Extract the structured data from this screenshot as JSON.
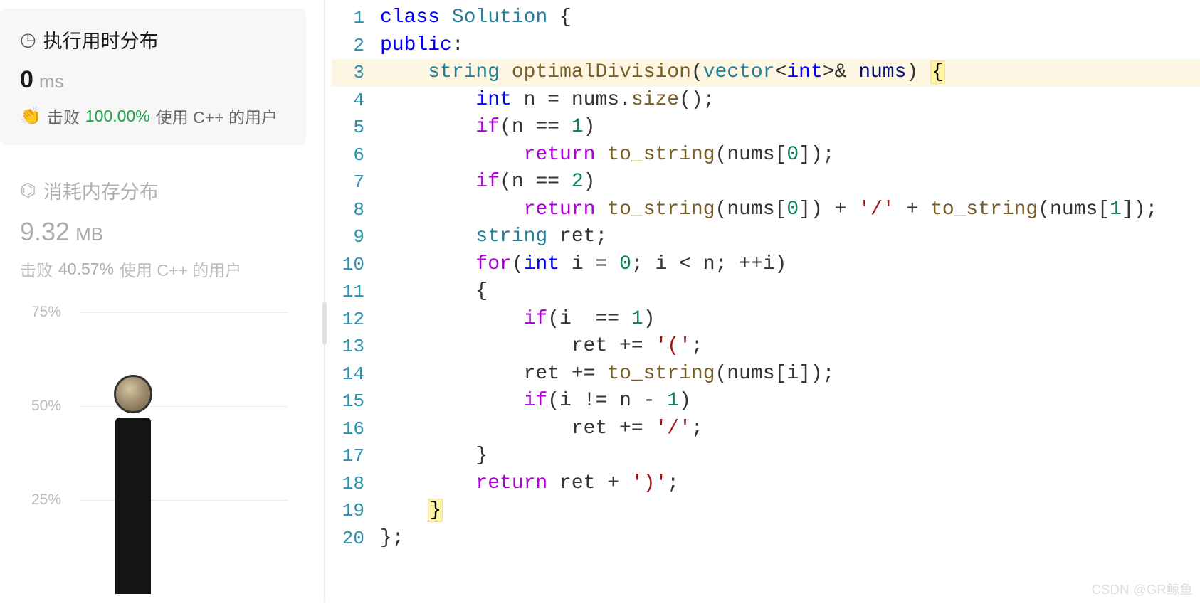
{
  "sidebar": {
    "runtime": {
      "title": "执行用时分布",
      "value": "0",
      "unit": "ms",
      "beats_label": "击败",
      "beats_pct": "100.00%",
      "beats_suffix": "使用 C++ 的用户"
    },
    "memory": {
      "title": "消耗内存分布",
      "value": "9.32",
      "unit": "MB",
      "beats_label": "击败",
      "beats_pct": "40.57%",
      "beats_suffix": "使用 C++ 的用户"
    }
  },
  "chart_data": {
    "type": "bar",
    "ylabels": [
      "75%",
      "50%",
      "25%"
    ],
    "series": [
      {
        "name": "memory",
        "values": [
          62
        ]
      }
    ],
    "avatar_above_bar": true,
    "ylim": [
      0,
      75
    ]
  },
  "code": {
    "highlighted_line": 3,
    "lines": [
      {
        "n": 1,
        "tokens": [
          {
            "t": "class ",
            "c": "tok-key"
          },
          {
            "t": "Solution",
            "c": "tok-cls"
          },
          {
            "t": " {",
            "c": "tok-punct"
          }
        ]
      },
      {
        "n": 2,
        "tokens": [
          {
            "t": "public",
            "c": "tok-key"
          },
          {
            "t": ":",
            "c": "tok-punct"
          }
        ]
      },
      {
        "n": 3,
        "tokens": [
          {
            "t": "    ",
            "c": ""
          },
          {
            "t": "string",
            "c": "tok-type"
          },
          {
            "t": " ",
            "c": ""
          },
          {
            "t": "optimalDivision",
            "c": "tok-func"
          },
          {
            "t": "(",
            "c": "tok-punct"
          },
          {
            "t": "vector",
            "c": "tok-type"
          },
          {
            "t": "<",
            "c": "tok-punct"
          },
          {
            "t": "int",
            "c": "tok-key"
          },
          {
            "t": ">& ",
            "c": "tok-punct"
          },
          {
            "t": "nums",
            "c": "tok-ident"
          },
          {
            "t": ") ",
            "c": "tok-punct"
          },
          {
            "t": "{",
            "c": "tok-brace-y"
          }
        ]
      },
      {
        "n": 4,
        "tokens": [
          {
            "t": "        ",
            "c": ""
          },
          {
            "t": "int",
            "c": "tok-key"
          },
          {
            "t": " n = nums.",
            "c": "tok-punct"
          },
          {
            "t": "size",
            "c": "tok-func"
          },
          {
            "t": "();",
            "c": "tok-punct"
          }
        ]
      },
      {
        "n": 5,
        "tokens": [
          {
            "t": "        ",
            "c": ""
          },
          {
            "t": "if",
            "c": "tok-purple"
          },
          {
            "t": "(n == ",
            "c": "tok-punct"
          },
          {
            "t": "1",
            "c": "tok-num"
          },
          {
            "t": ")",
            "c": "tok-punct"
          }
        ]
      },
      {
        "n": 6,
        "tokens": [
          {
            "t": "            ",
            "c": ""
          },
          {
            "t": "return",
            "c": "tok-purple"
          },
          {
            "t": " ",
            "c": ""
          },
          {
            "t": "to_string",
            "c": "tok-func"
          },
          {
            "t": "(nums[",
            "c": "tok-punct"
          },
          {
            "t": "0",
            "c": "tok-num"
          },
          {
            "t": "]);",
            "c": "tok-punct"
          }
        ]
      },
      {
        "n": 7,
        "tokens": [
          {
            "t": "        ",
            "c": ""
          },
          {
            "t": "if",
            "c": "tok-purple"
          },
          {
            "t": "(n == ",
            "c": "tok-punct"
          },
          {
            "t": "2",
            "c": "tok-num"
          },
          {
            "t": ")",
            "c": "tok-punct"
          }
        ]
      },
      {
        "n": 8,
        "tokens": [
          {
            "t": "            ",
            "c": ""
          },
          {
            "t": "return",
            "c": "tok-purple"
          },
          {
            "t": " ",
            "c": ""
          },
          {
            "t": "to_string",
            "c": "tok-func"
          },
          {
            "t": "(nums[",
            "c": "tok-punct"
          },
          {
            "t": "0",
            "c": "tok-num"
          },
          {
            "t": "]) + ",
            "c": "tok-punct"
          },
          {
            "t": "'/'",
            "c": "tok-str"
          },
          {
            "t": " + ",
            "c": "tok-punct"
          },
          {
            "t": "to_string",
            "c": "tok-func"
          },
          {
            "t": "(nums[",
            "c": "tok-punct"
          },
          {
            "t": "1",
            "c": "tok-num"
          },
          {
            "t": "]);",
            "c": "tok-punct"
          }
        ]
      },
      {
        "n": 9,
        "tokens": [
          {
            "t": "        ",
            "c": ""
          },
          {
            "t": "string",
            "c": "tok-type"
          },
          {
            "t": " ret;",
            "c": "tok-punct"
          }
        ]
      },
      {
        "n": 10,
        "tokens": [
          {
            "t": "        ",
            "c": ""
          },
          {
            "t": "for",
            "c": "tok-purple"
          },
          {
            "t": "(",
            "c": "tok-punct"
          },
          {
            "t": "int",
            "c": "tok-key"
          },
          {
            "t": " i = ",
            "c": "tok-punct"
          },
          {
            "t": "0",
            "c": "tok-num"
          },
          {
            "t": "; i < n; ++i)",
            "c": "tok-punct"
          }
        ]
      },
      {
        "n": 11,
        "tokens": [
          {
            "t": "        {",
            "c": "tok-punct"
          }
        ]
      },
      {
        "n": 12,
        "tokens": [
          {
            "t": "            ",
            "c": ""
          },
          {
            "t": "if",
            "c": "tok-purple"
          },
          {
            "t": "(i  == ",
            "c": "tok-punct"
          },
          {
            "t": "1",
            "c": "tok-num"
          },
          {
            "t": ")",
            "c": "tok-punct"
          }
        ]
      },
      {
        "n": 13,
        "tokens": [
          {
            "t": "                ret += ",
            "c": "tok-punct"
          },
          {
            "t": "'('",
            "c": "tok-str"
          },
          {
            "t": ";",
            "c": "tok-punct"
          }
        ]
      },
      {
        "n": 14,
        "tokens": [
          {
            "t": "            ret += ",
            "c": "tok-punct"
          },
          {
            "t": "to_string",
            "c": "tok-func"
          },
          {
            "t": "(nums[i]);",
            "c": "tok-punct"
          }
        ]
      },
      {
        "n": 15,
        "tokens": [
          {
            "t": "            ",
            "c": ""
          },
          {
            "t": "if",
            "c": "tok-purple"
          },
          {
            "t": "(i != n - ",
            "c": "tok-punct"
          },
          {
            "t": "1",
            "c": "tok-num"
          },
          {
            "t": ")",
            "c": "tok-punct"
          }
        ]
      },
      {
        "n": 16,
        "tokens": [
          {
            "t": "                ret += ",
            "c": "tok-punct"
          },
          {
            "t": "'/'",
            "c": "tok-str"
          },
          {
            "t": ";",
            "c": "tok-punct"
          }
        ]
      },
      {
        "n": 17,
        "tokens": [
          {
            "t": "        }",
            "c": "tok-punct"
          }
        ]
      },
      {
        "n": 18,
        "tokens": [
          {
            "t": "        ",
            "c": ""
          },
          {
            "t": "return",
            "c": "tok-purple"
          },
          {
            "t": " ret + ",
            "c": "tok-punct"
          },
          {
            "t": "')'",
            "c": "tok-str"
          },
          {
            "t": ";",
            "c": "tok-punct"
          }
        ]
      },
      {
        "n": 19,
        "tokens": [
          {
            "t": "    ",
            "c": ""
          },
          {
            "t": "}",
            "c": "tok-brace-y"
          }
        ]
      },
      {
        "n": 20,
        "tokens": [
          {
            "t": "};",
            "c": "tok-punct"
          }
        ]
      }
    ]
  },
  "watermark": "CSDN @GR鲸鱼"
}
